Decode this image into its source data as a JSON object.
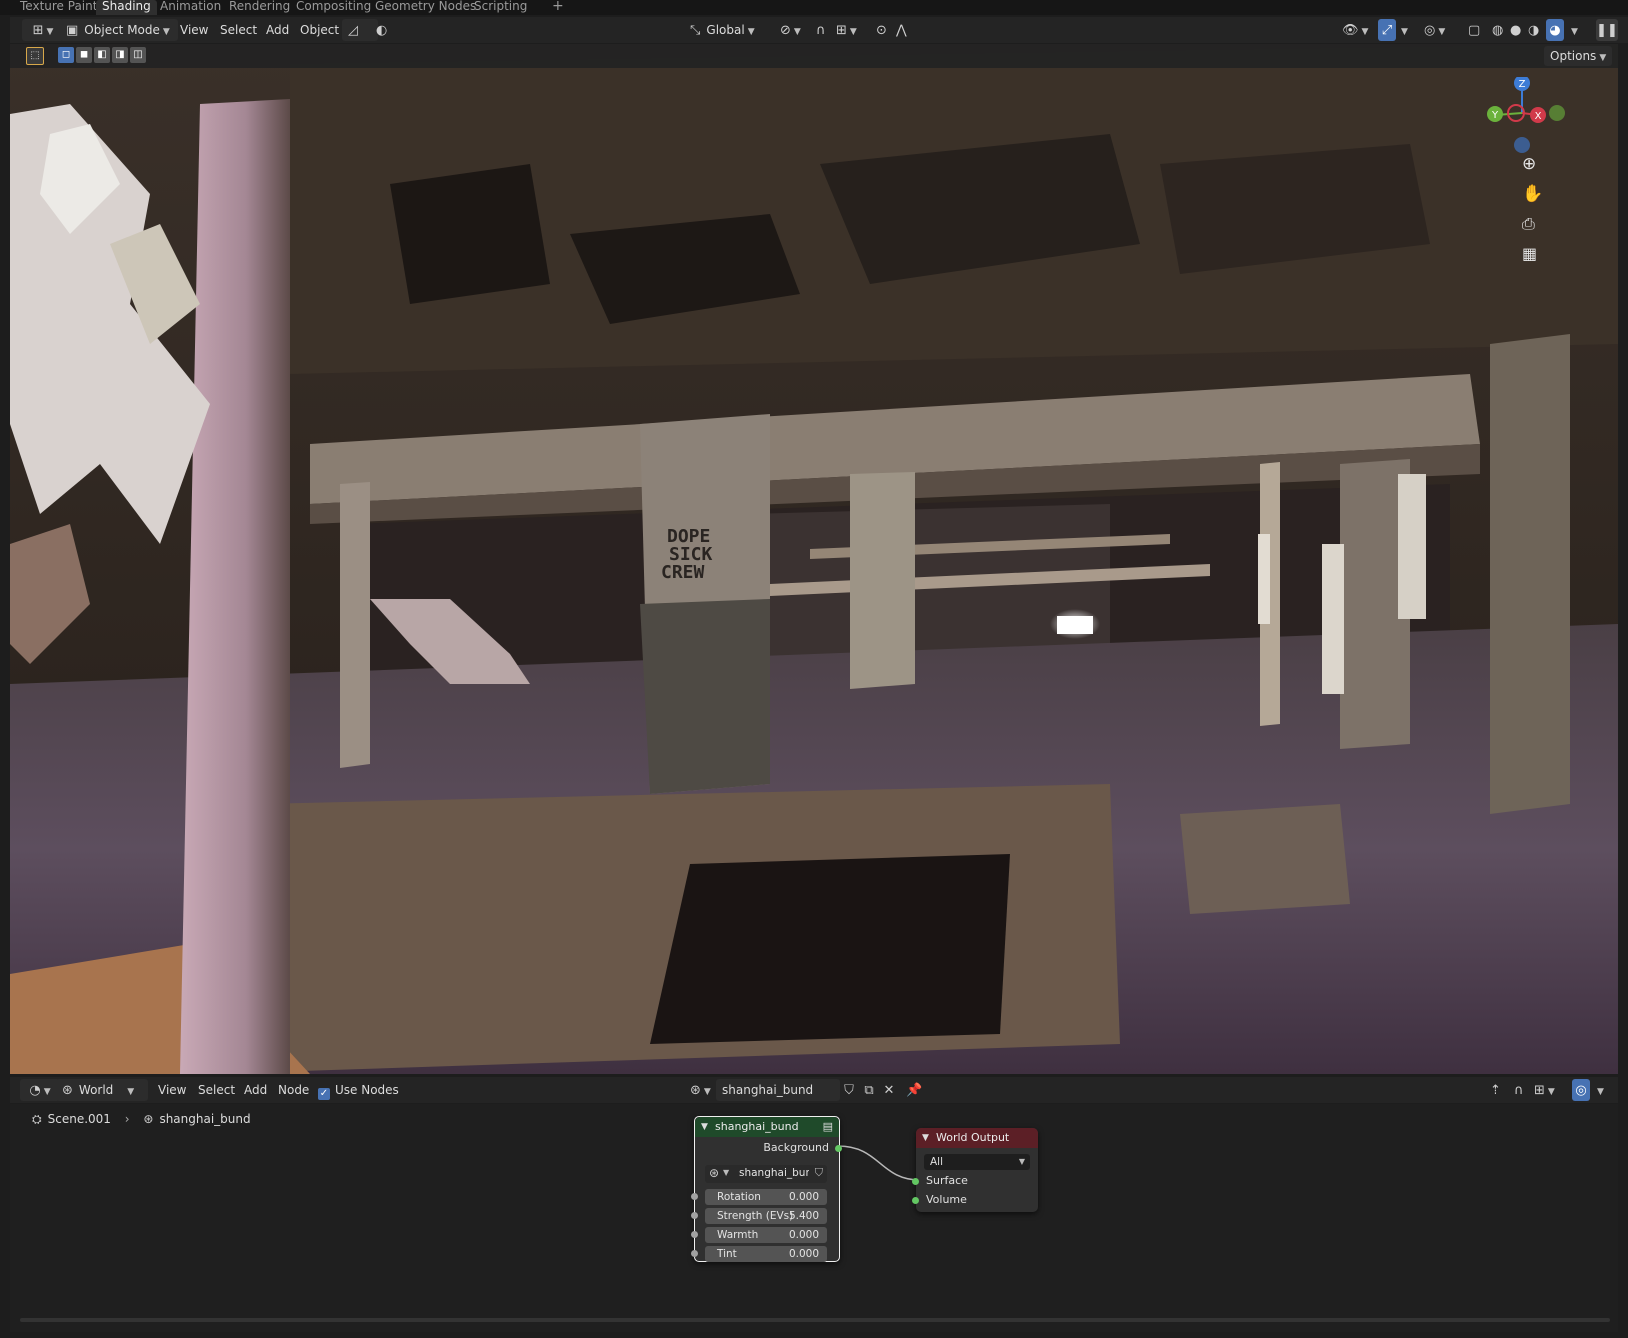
{
  "workspace_tabs": [
    "Texture Paint",
    "Shading",
    "Animation",
    "Rendering",
    "Compositing",
    "Geometry Nodes",
    "Scripting",
    "+"
  ],
  "active_tab": "Shading",
  "viewport_header": {
    "mode": "Object Mode",
    "menus": [
      "View",
      "Select",
      "Add",
      "Object"
    ],
    "transform_orientation": "Global",
    "options_label": "Options"
  },
  "gizmo": {
    "z": "Z",
    "y": "Y",
    "x": "X"
  },
  "scene_graffiti": "DOPE SICK CREW",
  "node_editor_header": {
    "type": "World",
    "menus": [
      "View",
      "Select",
      "Add",
      "Node"
    ],
    "use_nodes_label": "Use Nodes",
    "use_nodes_checked": true,
    "world_name": "shanghai_bund"
  },
  "breadcrumb": {
    "scene": "Scene.001",
    "world": "shanghai_bund"
  },
  "env_node": {
    "title": "shanghai_bund",
    "output": "Background",
    "image": "shanghai_bund",
    "fields": [
      {
        "label": "Rotation",
        "value": "0.000"
      },
      {
        "label": "Strength (EVs)",
        "value": "5.400"
      },
      {
        "label": "Warmth",
        "value": "0.000"
      },
      {
        "label": "Tint",
        "value": "0.000"
      }
    ]
  },
  "world_output_node": {
    "title": "World Output",
    "target": "All",
    "inputs": [
      "Surface",
      "Volume"
    ]
  },
  "colors": {
    "accent": "#4772b3",
    "socket_green": "#63c763",
    "header_red": "#5c1f26",
    "node_green": "#1f4a2a"
  }
}
